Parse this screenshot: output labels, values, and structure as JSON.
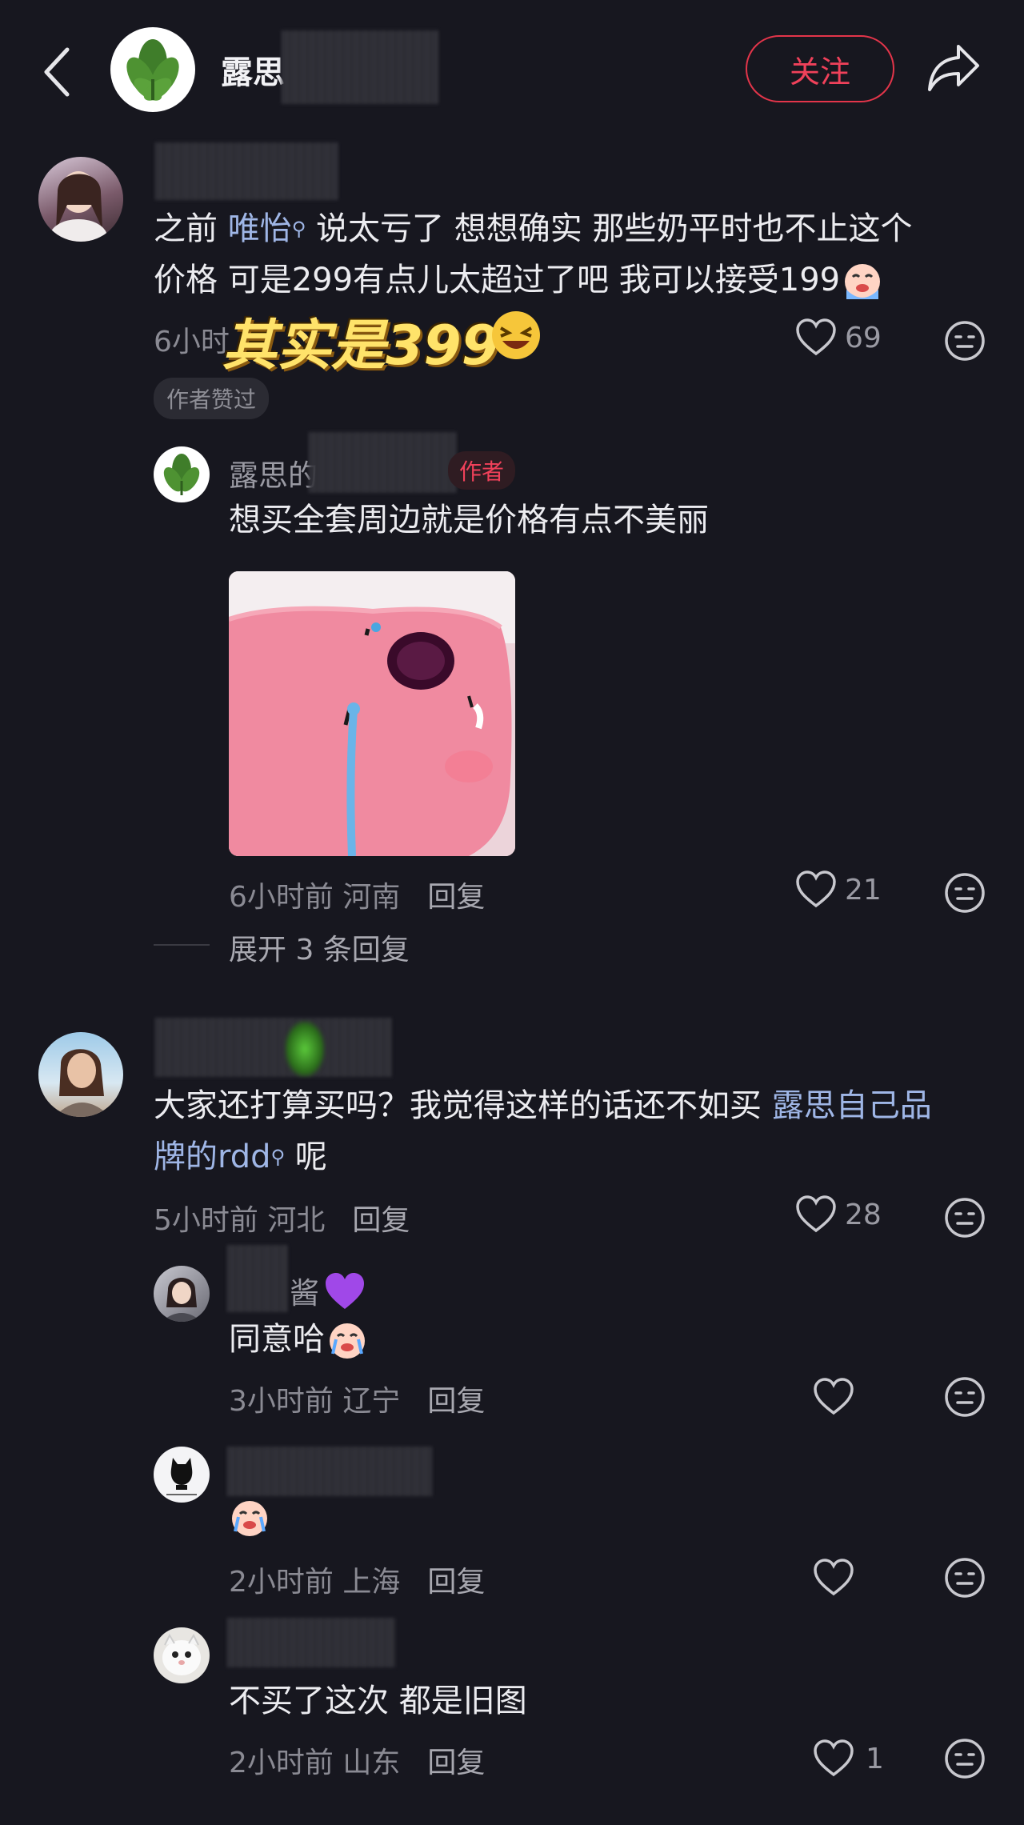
{
  "header": {
    "username": "露思",
    "follow_label": "关注"
  },
  "comments": [
    {
      "text_parts": [
        "之前 ",
        "唯怡",
        " 说太亏了 想想确实 那些奶平时也不止这个"
      ],
      "text_line2": "价格 可是299有点儿太超过了吧 我可以接受199",
      "meta_prefix": "6小时",
      "overlay": "其实是399",
      "likes": "69",
      "badge": "作者赞过"
    },
    {
      "name": "露思的",
      "author_tag": "作者",
      "text": "想买全套周边就是价格有点不美丽",
      "meta": "6小时前 河南",
      "reply": "回复",
      "likes": "21"
    },
    {
      "expand": "展开 3 条回复"
    },
    {
      "text_line1_a": "大家还打算买吗？我觉得这样的话还不如买 ",
      "text_line1_link": "露思自己品",
      "text_line2_link": "牌的rdd",
      "text_line2_b": " 呢",
      "meta": "5小时前 河北",
      "reply": "回复",
      "likes": "28"
    },
    {
      "name": "酱",
      "text": "同意哈",
      "meta": "3小时前 辽宁",
      "reply": "回复"
    },
    {
      "meta": "2小时前 上海",
      "reply": "回复"
    },
    {
      "text": "不买了这次 都是旧图",
      "meta": "2小时前 山东",
      "reply": "回复",
      "likes": "1"
    }
  ],
  "colors": {
    "background": "#17171f",
    "accent_red": "#f0415a",
    "link_blue": "#9fb6e6"
  },
  "icons": [
    "back-icon",
    "share-icon",
    "heart-icon",
    "emoji-face-icon",
    "search-hint-icon"
  ]
}
